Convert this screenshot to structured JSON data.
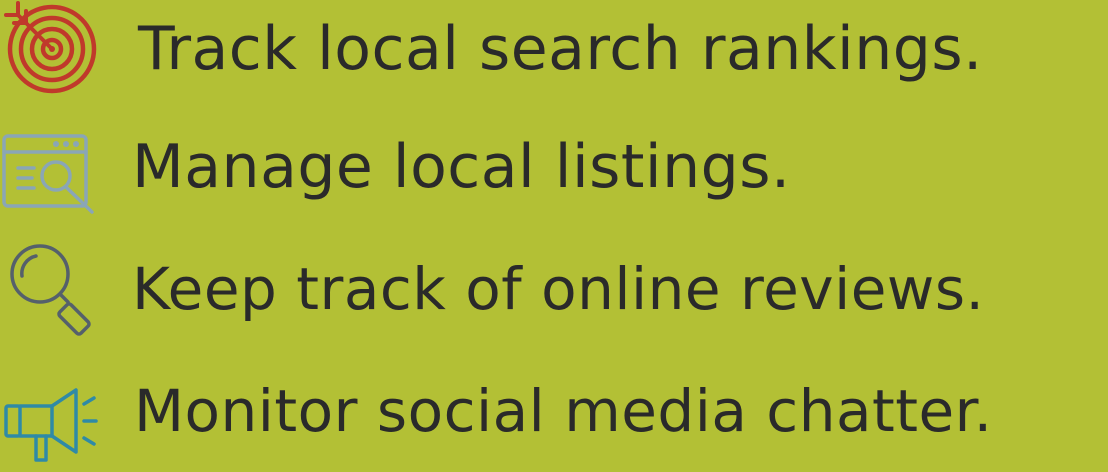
{
  "colors": {
    "background": "#b3c035",
    "text": "#2a2a2a",
    "target_icon": "#c0392b",
    "listing_icon": "#8aa6b6",
    "search_icon": "#55606b",
    "megaphone_icon": "#2f8aa6"
  },
  "features": [
    {
      "icon": "target-icon",
      "text": "Track local search rankings."
    },
    {
      "icon": "browser-search-icon",
      "text": "Manage local listings."
    },
    {
      "icon": "magnifier-icon",
      "text": "Keep track of online reviews."
    },
    {
      "icon": "megaphone-icon",
      "text": "Monitor social media chatter."
    }
  ]
}
